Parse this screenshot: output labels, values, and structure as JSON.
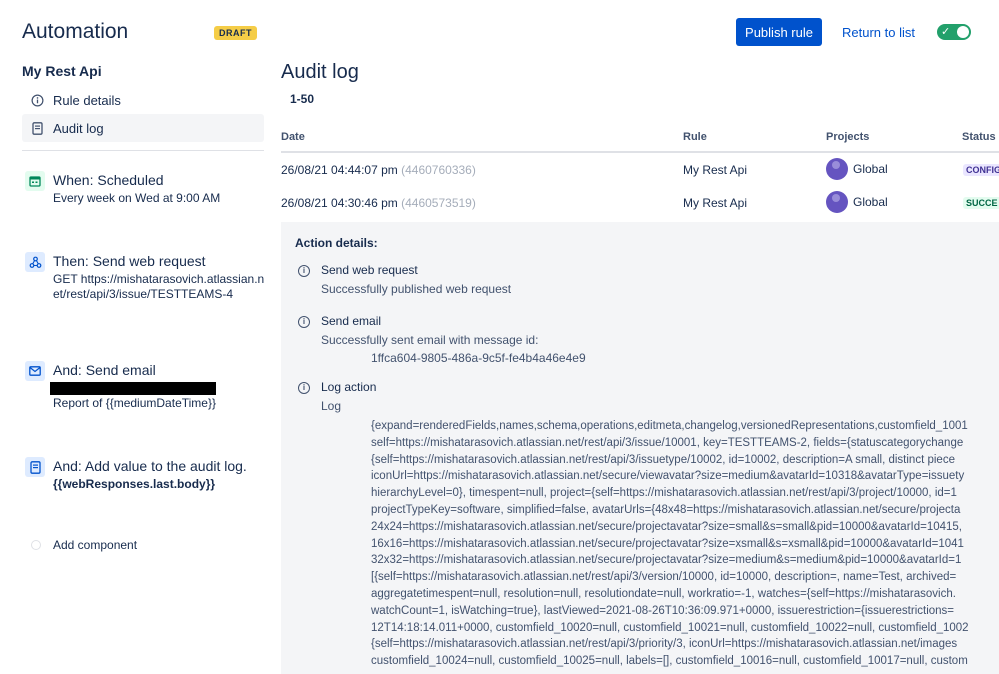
{
  "header": {
    "title": "Automation",
    "badge": "DRAFT",
    "publish_label": "Publish rule",
    "return_label": "Return to list",
    "toggle_state": "on"
  },
  "sidebar": {
    "rule_name": "My Rest Api",
    "nav": [
      {
        "label": "Rule details",
        "icon": "info-icon"
      },
      {
        "label": "Audit log",
        "icon": "document-icon",
        "active": true
      }
    ],
    "components": [
      {
        "title": "When: Scheduled",
        "subtitle": "Every week on Wed at 9:00 AM",
        "icon": "calendar-icon"
      },
      {
        "title": "Then: Send web request",
        "subtitle": "GET https://mishatarasovich.atlassian.net/rest/api/3/issue/TESTTEAMS-4",
        "icon": "webhook-icon"
      },
      {
        "title": "And: Send email",
        "subtitle": "Report of {{mediumDateTime}}",
        "icon": "email-icon"
      },
      {
        "title": "And: Add value to the audit log.",
        "subtitle": "{{webResponses.last.body}}",
        "icon": "document-icon"
      }
    ],
    "add_component": "Add component"
  },
  "main": {
    "title": "Audit log",
    "range": "1-50",
    "columns": [
      "Date",
      "Rule",
      "Projects",
      "Status"
    ],
    "rows": [
      {
        "date": "26/08/21 04:44:07 pm",
        "id": "(4460760336)",
        "rule": "My Rest Api",
        "project": "Global",
        "status": "CONFIG"
      },
      {
        "date": "26/08/21 04:30:46 pm",
        "id": "(4460573519)",
        "rule": "My Rest Api",
        "project": "Global",
        "status": "SUCCE"
      }
    ],
    "details": {
      "title": "Action details:",
      "actions": [
        {
          "title": "Send web request",
          "sub": "Successfully published web request"
        },
        {
          "title": "Send email",
          "sub": "Successfully sent email with message id:",
          "extra": "1ffca604-9805-486a-9c5f-fe4b4a46e4e9"
        },
        {
          "title": "Log action",
          "sub": "Log"
        }
      ],
      "log_lines": [
        "{expand=renderedFields,names,schema,operations,editmeta,changelog,versionedRepresentations,customfield_1001",
        "self=https://mishatarasovich.atlassian.net/rest/api/3/issue/10001, key=TESTTEAMS-2, fields={statuscategorychange",
        "{self=https://mishatarasovich.atlassian.net/rest/api/3/issuetype/10002, id=10002, description=A small, distinct piece",
        "iconUrl=https://mishatarasovich.atlassian.net/secure/viewavatar?size=medium&avatarId=10318&avatarType=issuety",
        "hierarchyLevel=0}, timespent=null, project={self=https://mishatarasovich.atlassian.net/rest/api/3/project/10000, id=1",
        "projectTypeKey=software, simplified=false, avatarUrls={48x48=https://mishatarasovich.atlassian.net/secure/projecta",
        "24x24=https://mishatarasovich.atlassian.net/secure/projectavatar?size=small&s=small&pid=10000&avatarId=10415,",
        "16x16=https://mishatarasovich.atlassian.net/secure/projectavatar?size=xsmall&s=xsmall&pid=10000&avatarId=1041",
        "32x32=https://mishatarasovich.atlassian.net/secure/projectavatar?size=medium&s=medium&pid=10000&avatarId=1",
        "[{self=https://mishatarasovich.atlassian.net/rest/api/3/version/10000, id=10000, description=, name=Test, archived=",
        "aggregatetimespent=null, resolution=null, resolutiondate=null, workratio=-1, watches={self=https://mishatarasovich.",
        "watchCount=1, isWatching=true}, lastViewed=2021-08-26T10:36:09.971+0000, issuerestriction={issuerestrictions=",
        "12T14:18:14.011+0000, customfield_10020=null, customfield_10021=null, customfield_10022=null, customfield_1002",
        "{self=https://mishatarasovich.atlassian.net/rest/api/3/priority/3, iconUrl=https://mishatarasovich.atlassian.net/images",
        "customfield_10024=null, customfield_10025=null, labels=[], customfield_10016=null, customfield_10017=null, custom"
      ]
    }
  }
}
